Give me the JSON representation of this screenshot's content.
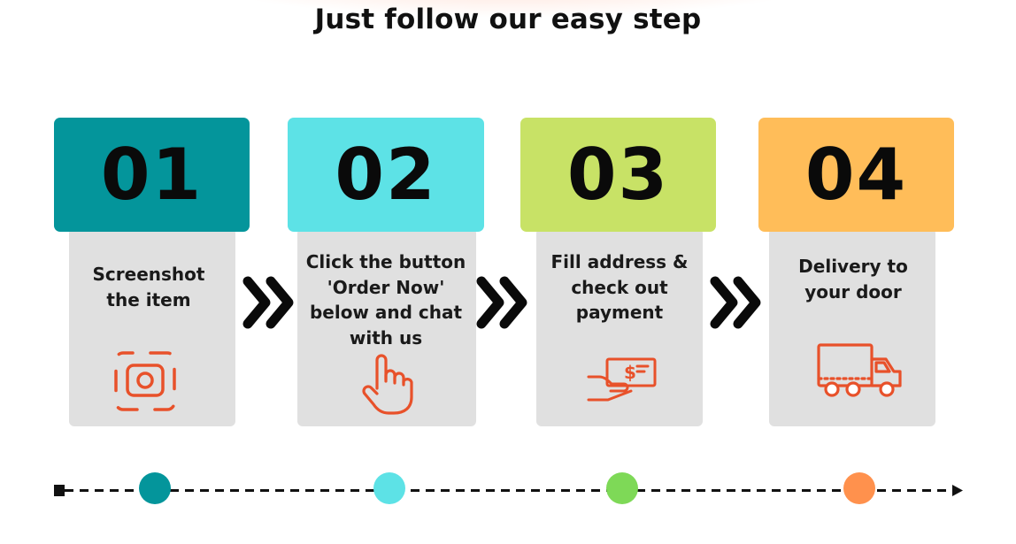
{
  "title": "Just follow our easy step",
  "steps": [
    {
      "number": "01",
      "text": "Screenshot the item",
      "color": "#04959b",
      "icon": "camera-focus-icon",
      "dot_color": "#04959b"
    },
    {
      "number": "02",
      "text": "Click the button 'Order Now' below and chat with us",
      "color": "#5de2e6",
      "icon": "hand-pointer-icon",
      "dot_color": "#5de2e6"
    },
    {
      "number": "03",
      "text": "Fill address & check out payment",
      "color": "#c8e266",
      "icon": "hand-payment-icon",
      "dot_color": "#7ed957"
    },
    {
      "number": "04",
      "text": "Delivery to your door",
      "color": "#ffbd59",
      "icon": "delivery-truck-icon",
      "dot_color": "#ff914d"
    }
  ],
  "icon_color": "#e8512a",
  "arrow_icon": "double-chevron-right-icon",
  "timeline": {
    "line_color": "#111111",
    "style": "dashed"
  }
}
